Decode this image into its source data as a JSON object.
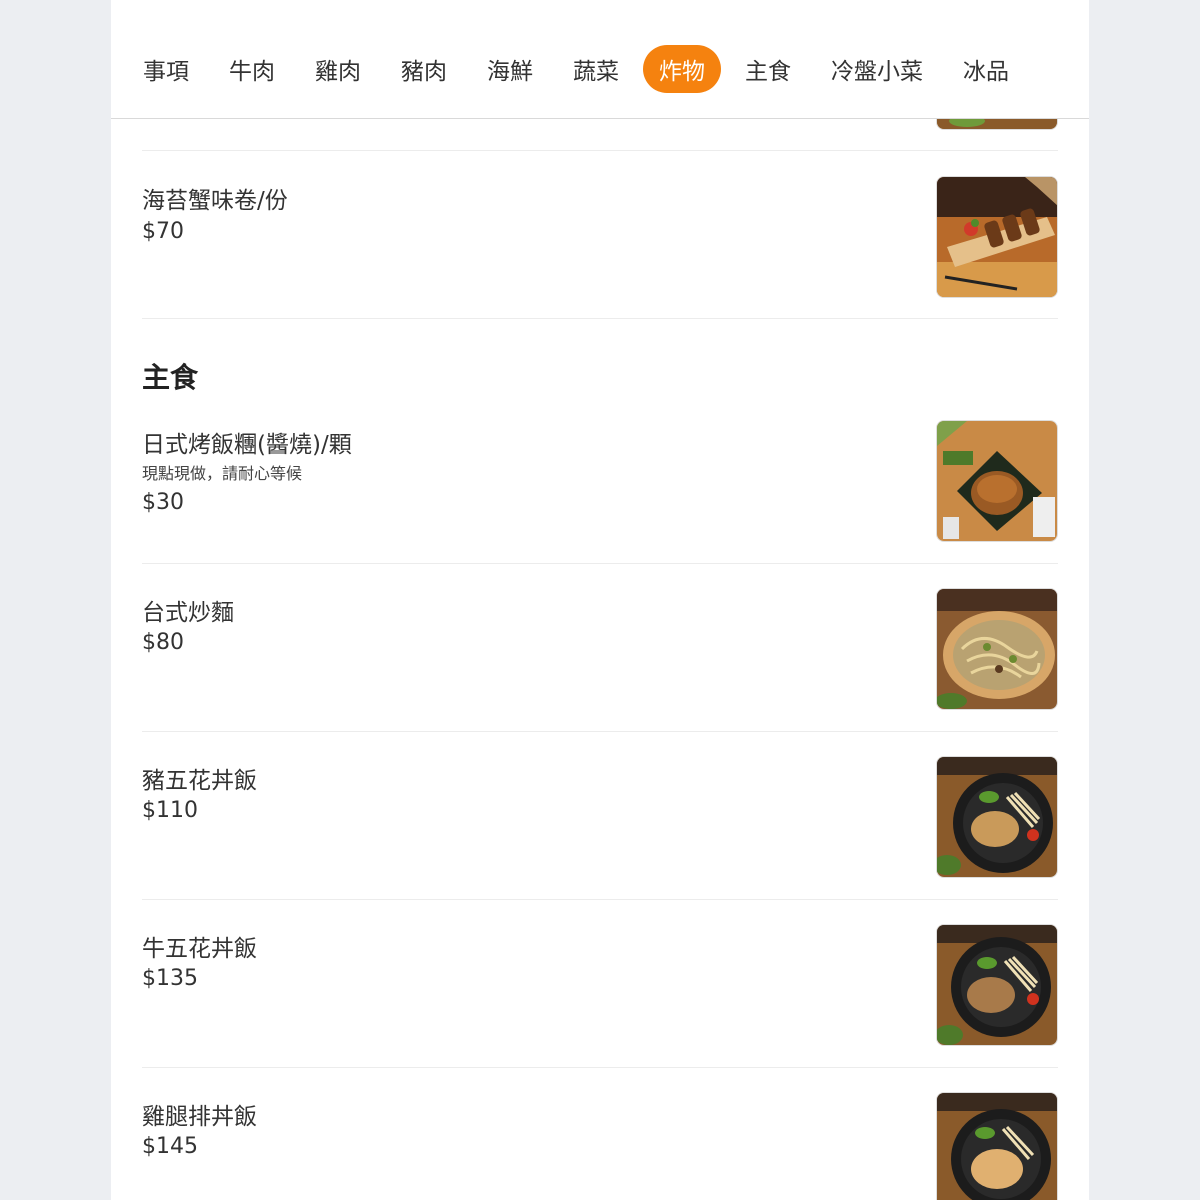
{
  "tabs": [
    {
      "label": "事項"
    },
    {
      "label": "牛肉"
    },
    {
      "label": "雞肉"
    },
    {
      "label": "豬肉"
    },
    {
      "label": "海鮮"
    },
    {
      "label": "蔬菜"
    },
    {
      "label": "炸物",
      "active": true
    },
    {
      "label": "主食"
    },
    {
      "label": "冷盤小菜"
    },
    {
      "label": "冰品"
    }
  ],
  "colors": {
    "accent": "#f5820f",
    "text": "#333333",
    "divider": "#ececec"
  },
  "fried": {
    "items": [
      {
        "name": "海苔蟹味卷/份",
        "price": "$70",
        "image_icon": "fried-rolls-photo"
      }
    ]
  },
  "main_dishes": {
    "title": "主食",
    "items": [
      {
        "name": "日式烤飯糰(醬燒)/顆",
        "note": "現點現做，請耐心等候",
        "price": "$30",
        "image_icon": "rice-ball-photo"
      },
      {
        "name": "台式炒麵",
        "price": "$80",
        "image_icon": "fried-noodles-photo"
      },
      {
        "name": "豬五花丼飯",
        "price": "$110",
        "image_icon": "pork-rice-bowl-photo"
      },
      {
        "name": "牛五花丼飯",
        "price": "$135",
        "image_icon": "beef-rice-bowl-photo"
      },
      {
        "name": "雞腿排丼飯",
        "price": "$145",
        "image_icon": "chicken-rice-bowl-photo"
      }
    ]
  }
}
